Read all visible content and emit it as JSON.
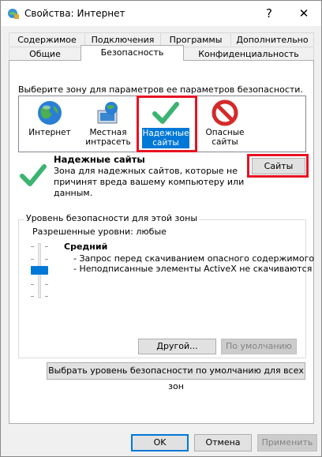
{
  "window": {
    "title": "Свойства: Интернет",
    "help": "?",
    "close": "✕"
  },
  "tabs": {
    "row1": [
      "Содержимое",
      "Подключения",
      "Программы",
      "Дополнительно"
    ],
    "row2": [
      "Общие",
      "Безопасность",
      "Конфиденциальность"
    ],
    "active": "Безопасность"
  },
  "security": {
    "instruction": "Выберите зону для параметров ее параметров безопасности.",
    "zones": [
      {
        "label": "Интернет",
        "icon": "globe-icon",
        "selected": false
      },
      {
        "label": "Местная интрасеть",
        "icon": "local-intranet-icon",
        "selected": false
      },
      {
        "label": "Надежные сайты",
        "icon": "checkmark-icon",
        "selected": true
      },
      {
        "label": "Опасные сайты",
        "icon": "restricted-icon",
        "selected": false
      }
    ],
    "selected_zone": {
      "title": "Надежные сайты",
      "description_line1": "Зона для надежных сайтов, которые не",
      "description_line2": "причинят вреда вашему компьютеру или",
      "description_line3": "данным.",
      "sites_button": "Сайты"
    },
    "level_group": {
      "title": "Уровень безопасности для этой зоны",
      "allowed_levels": "Разрешенные уровни: любые",
      "level_name": "Средний",
      "bullet1": "- Запрос перед скачиванием опасного содержимого",
      "bullet2": "- Неподписанные элементы ActiveX не скачиваются",
      "custom_button": "Другой...",
      "default_button": "По умолчанию",
      "slider_level_index": 2,
      "slider_levels_total": 4
    },
    "reset_all_button": "Выбрать уровень безопасности по умолчанию для всех зон"
  },
  "footer": {
    "ok": "OK",
    "cancel": "Отмена",
    "apply": "Применить"
  },
  "colors": {
    "accent": "#0078d7",
    "highlight_box": "#e81123",
    "check_green": "#3cb371"
  }
}
